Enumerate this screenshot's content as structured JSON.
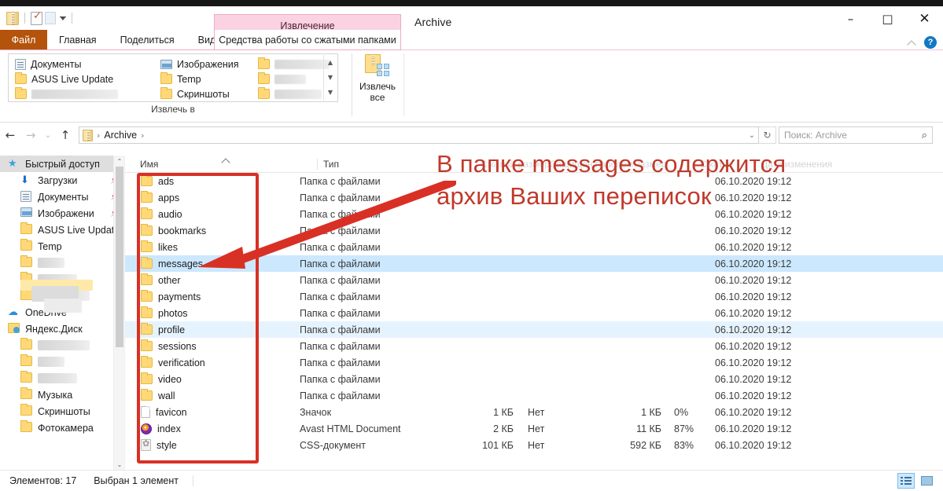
{
  "window": {
    "title": "Archive",
    "minimize": "–",
    "maximize": "□",
    "close": "✕"
  },
  "quick_access": {
    "zip_tooltip": "zip",
    "properties": "properties",
    "paste": "paste",
    "customize": "customize"
  },
  "ribbon": {
    "contextual_title": "Извлечение",
    "tabs": [
      {
        "label": "Файл",
        "type": "file"
      },
      {
        "label": "Главная",
        "type": "normal"
      },
      {
        "label": "Поделиться",
        "type": "normal"
      },
      {
        "label": "Вид",
        "type": "normal"
      }
    ],
    "contextual_tab": "Средства работы со сжатыми папками",
    "group_label": "Извлечь в",
    "gallery_items_col1": [
      "Документы",
      "ASUS Live Update",
      ""
    ],
    "gallery_items_col2": [
      "Изображения",
      "Temp",
      "Скриншоты"
    ],
    "extract_all": "Извлечь все",
    "help": "?"
  },
  "addressbar": {
    "back": "←",
    "forward": "→",
    "recent": "⌄",
    "up": "↑",
    "crumb_root": "Archive",
    "crumb_sep": "›",
    "dropdown": "⌄",
    "refresh": "↻",
    "search_placeholder": "Поиск: Archive",
    "search_icon": "⌕"
  },
  "columns": [
    {
      "key": "name",
      "label": "Имя",
      "faint": false
    },
    {
      "key": "type",
      "label": "Тип",
      "faint": false
    },
    {
      "key": "csize",
      "label": "Сжатый размер",
      "faint": true
    },
    {
      "key": "prot",
      "label": "Защищен паролем",
      "faint": true
    },
    {
      "key": "size",
      "label": "Размер",
      "faint": true
    },
    {
      "key": "ratio",
      "label": "Сжатие",
      "faint": true
    },
    {
      "key": "date",
      "label": "Дата изменения",
      "faint": true
    }
  ],
  "navpane": {
    "items": [
      {
        "label": "Быстрый доступ",
        "icon": "star-icon",
        "selected": true,
        "indent": 0,
        "pinned": false,
        "blurred": false
      },
      {
        "label": "Загрузки",
        "icon": "download-icon",
        "selected": false,
        "indent": 1,
        "pinned": true,
        "blurred": false
      },
      {
        "label": "Документы",
        "icon": "document-icon",
        "selected": false,
        "indent": 1,
        "pinned": true,
        "blurred": false
      },
      {
        "label": "Изображени",
        "icon": "pictures-icon",
        "selected": false,
        "indent": 1,
        "pinned": true,
        "blurred": false
      },
      {
        "label": "ASUS Live Updat",
        "icon": "folder-icon",
        "selected": false,
        "indent": 1,
        "pinned": false,
        "blurred": false
      },
      {
        "label": "Temp",
        "icon": "folder-icon",
        "selected": false,
        "indent": 1,
        "pinned": false,
        "blurred": false
      },
      {
        "label": "",
        "icon": "folder-icon",
        "selected": false,
        "indent": 1,
        "pinned": false,
        "blurred": true
      },
      {
        "label": "",
        "icon": "folder-icon",
        "selected": false,
        "indent": 1,
        "pinned": false,
        "blurred": true
      },
      {
        "label": "",
        "icon": "folder-icon",
        "selected": false,
        "indent": 1,
        "pinned": false,
        "blurred": true
      },
      {
        "label": "OneDrive",
        "icon": "cloud-icon",
        "selected": false,
        "indent": 0,
        "pinned": false,
        "blurred": false
      },
      {
        "label": "Яндекс.Диск",
        "icon": "yandex-disk-icon",
        "selected": false,
        "indent": 0,
        "pinned": false,
        "blurred": false
      },
      {
        "label": "",
        "icon": "folder-icon",
        "selected": false,
        "indent": 1,
        "pinned": false,
        "blurred": true
      },
      {
        "label": "",
        "icon": "folder-icon",
        "selected": false,
        "indent": 1,
        "pinned": false,
        "blurred": true
      },
      {
        "label": "",
        "icon": "folder-icon",
        "selected": false,
        "indent": 1,
        "pinned": false,
        "blurred": true
      },
      {
        "label": "Музыка",
        "icon": "folder-icon",
        "selected": false,
        "indent": 1,
        "pinned": false,
        "blurred": false
      },
      {
        "label": "Скриншоты",
        "icon": "folder-icon",
        "selected": false,
        "indent": 1,
        "pinned": false,
        "blurred": false
      },
      {
        "label": "Фотокамера",
        "icon": "folder-icon",
        "selected": false,
        "indent": 1,
        "pinned": false,
        "blurred": false
      }
    ],
    "scroll_up": "⌃",
    "scroll_down": "⌄"
  },
  "files": [
    {
      "name": "ads",
      "icon": "folder-icon",
      "type": "Папка с файлами",
      "csize": "",
      "prot": "",
      "size": "",
      "ratio": "",
      "date": "06.10.2020 19:12",
      "state": ""
    },
    {
      "name": "apps",
      "icon": "folder-icon",
      "type": "Папка с файлами",
      "csize": "",
      "prot": "",
      "size": "",
      "ratio": "",
      "date": "06.10.2020 19:12",
      "state": ""
    },
    {
      "name": "audio",
      "icon": "folder-icon",
      "type": "Папка с файлами",
      "csize": "",
      "prot": "",
      "size": "",
      "ratio": "",
      "date": "06.10.2020 19:12",
      "state": ""
    },
    {
      "name": "bookmarks",
      "icon": "folder-icon",
      "type": "Папка с файлами",
      "csize": "",
      "prot": "",
      "size": "",
      "ratio": "",
      "date": "06.10.2020 19:12",
      "state": ""
    },
    {
      "name": "likes",
      "icon": "folder-icon",
      "type": "Папка с файлами",
      "csize": "",
      "prot": "",
      "size": "",
      "ratio": "",
      "date": "06.10.2020 19:12",
      "state": ""
    },
    {
      "name": "messages",
      "icon": "folder-icon",
      "type": "Папка с файлами",
      "csize": "",
      "prot": "",
      "size": "",
      "ratio": "",
      "date": "06.10.2020 19:12",
      "state": "sel"
    },
    {
      "name": "other",
      "icon": "folder-icon",
      "type": "Папка с файлами",
      "csize": "",
      "prot": "",
      "size": "",
      "ratio": "",
      "date": "06.10.2020 19:12",
      "state": ""
    },
    {
      "name": "payments",
      "icon": "folder-icon",
      "type": "Папка с файлами",
      "csize": "",
      "prot": "",
      "size": "",
      "ratio": "",
      "date": "06.10.2020 19:12",
      "state": ""
    },
    {
      "name": "photos",
      "icon": "folder-icon",
      "type": "Папка с файлами",
      "csize": "",
      "prot": "",
      "size": "",
      "ratio": "",
      "date": "06.10.2020 19:12",
      "state": ""
    },
    {
      "name": "profile",
      "icon": "folder-icon",
      "type": "Папка с файлами",
      "csize": "",
      "prot": "",
      "size": "",
      "ratio": "",
      "date": "06.10.2020 19:12",
      "state": "sel2"
    },
    {
      "name": "sessions",
      "icon": "folder-icon",
      "type": "Папка с файлами",
      "csize": "",
      "prot": "",
      "size": "",
      "ratio": "",
      "date": "06.10.2020 19:12",
      "state": ""
    },
    {
      "name": "verification",
      "icon": "folder-icon",
      "type": "Папка с файлами",
      "csize": "",
      "prot": "",
      "size": "",
      "ratio": "",
      "date": "06.10.2020 19:12",
      "state": ""
    },
    {
      "name": "video",
      "icon": "folder-icon",
      "type": "Папка с файлами",
      "csize": "",
      "prot": "",
      "size": "",
      "ratio": "",
      "date": "06.10.2020 19:12",
      "state": ""
    },
    {
      "name": "wall",
      "icon": "folder-icon",
      "type": "Папка с файлами",
      "csize": "",
      "prot": "",
      "size": "",
      "ratio": "",
      "date": "06.10.2020 19:12",
      "state": ""
    },
    {
      "name": "favicon",
      "icon": "generic-file-icon",
      "type": "Значок",
      "csize": "1 КБ",
      "prot": "Нет",
      "size": "1 КБ",
      "ratio": "0%",
      "date": "06.10.2020 19:12",
      "state": ""
    },
    {
      "name": "index",
      "icon": "avast-browser-icon",
      "type": "Avast HTML Document",
      "csize": "2 КБ",
      "prot": "Нет",
      "size": "11 КБ",
      "ratio": "87%",
      "date": "06.10.2020 19:12",
      "state": ""
    },
    {
      "name": "style",
      "icon": "css-file-icon",
      "type": "CSS-документ",
      "csize": "101 КБ",
      "prot": "Нет",
      "size": "592 КБ",
      "ratio": "83%",
      "date": "06.10.2020 19:12",
      "state": ""
    }
  ],
  "statusbar": {
    "count": "Элементов: 17",
    "selection": "Выбран 1 элемент",
    "view_details": "details-view",
    "view_large": "large-icons-view"
  },
  "annotation": {
    "line1": "В папке messages содержится",
    "line2": "архив Ваших переписок",
    "color": "#c0392b"
  }
}
